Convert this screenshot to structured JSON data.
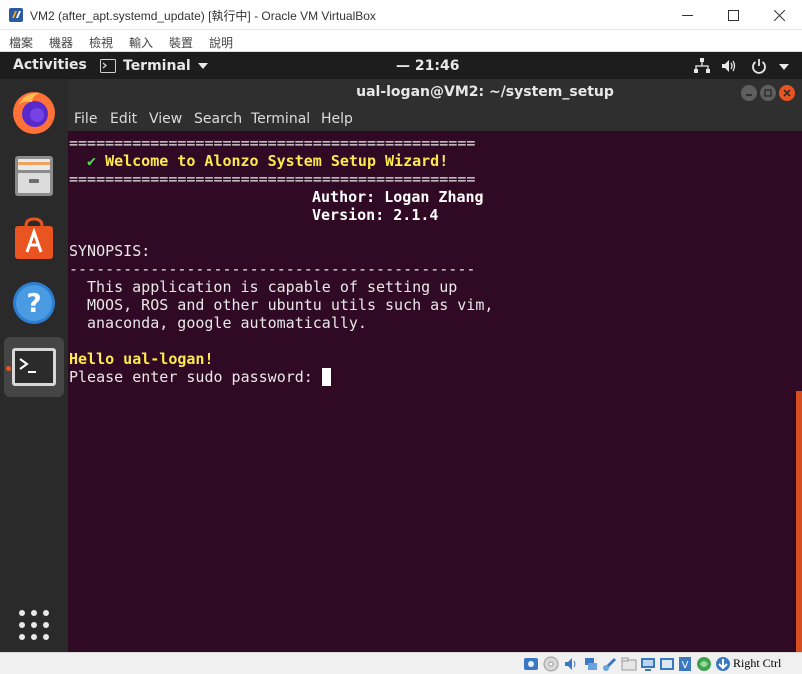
{
  "vbox": {
    "title": "VM2 (after_apt.systemd_update) [執行中] - Oracle VM VirtualBox",
    "menu": [
      "檔案",
      "機器",
      "檢視",
      "輸入",
      "裝置",
      "說明"
    ],
    "host_key": "Right Ctrl"
  },
  "ubuntu": {
    "activities": "Activities",
    "app_menu": "Terminal",
    "clock": "21:46",
    "clock_prefix": "—",
    "dock": [
      "firefox-icon",
      "files-icon",
      "software-icon",
      "help-icon",
      "terminal-icon",
      "show-apps-icon"
    ]
  },
  "terminal": {
    "title": "ual-logan@VM2: ~/system_setup",
    "menu": [
      "File",
      "Edit",
      "View",
      "Search",
      "Terminal",
      "Help"
    ],
    "lines": {
      "rule_top": "=============================================",
      "check": "✔",
      "welcome": "Welcome to Alonzo System Setup Wizard!",
      "rule_mid": "=============================================",
      "author": "Author: Logan Zhang",
      "version": "Version: 2.1.4",
      "synopsis": "SYNOPSIS:",
      "rule_dash": "---------------------------------------------",
      "desc1": "This application is capable of setting up",
      "desc2": "MOOS, ROS and other ubuntu utils such as vim,",
      "desc3": "anaconda, google automatically.",
      "hello": "Hello ual-logan!",
      "prompt": "Please enter sudo password: "
    }
  },
  "colors": {
    "terminal_bg": "#300a24",
    "yellow_text": "#fce94f",
    "accent": "#e95420"
  }
}
